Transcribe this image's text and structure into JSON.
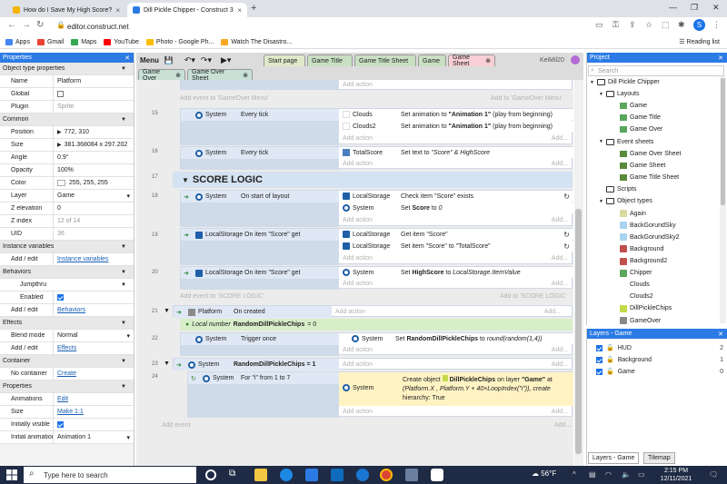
{
  "browser": {
    "tabs": [
      {
        "title": "How do I Save My High Score?",
        "fav_color": "#f4b400"
      },
      {
        "title": "Dill Pickle Chipper - Construct 3",
        "fav_color": "#2c7be5"
      }
    ],
    "url": "editor.construct.net",
    "profile_initial": "S",
    "bookmarks": [
      {
        "label": "Apps",
        "color": "#4285f4"
      },
      {
        "label": "Gmail",
        "color": "#ea4335"
      },
      {
        "label": "Maps",
        "color": "#34a853"
      },
      {
        "label": "YouTube",
        "color": "#ff0000"
      },
      {
        "label": "Photo - Google Ph...",
        "color": "#fbbc04"
      },
      {
        "label": "Watch The Disastro...",
        "color": "#f9a825"
      }
    ],
    "reading_list": "Reading list"
  },
  "properties": {
    "header": "Properties",
    "rows": [
      {
        "k": "Object type properties",
        "sec": true
      },
      {
        "k": "Name",
        "v": "Platform"
      },
      {
        "k": "Global",
        "chk": false
      },
      {
        "k": "Plugin",
        "v": "Sprite",
        "dim": true
      },
      {
        "k": "Common",
        "sec": true
      },
      {
        "k": "Position",
        "v": "772, 310",
        "arr": true
      },
      {
        "k": "Size",
        "v": "381.368084 x 297.202",
        "arr": true
      },
      {
        "k": "Angle",
        "v": "0.9°"
      },
      {
        "k": "Opacity",
        "v": "100%"
      },
      {
        "k": "Color",
        "v": "255, 255, 255",
        "swatch": true
      },
      {
        "k": "Layer",
        "v": "Game"
      },
      {
        "k": "Z elevation",
        "v": "0"
      },
      {
        "k": "Z index",
        "v": "12 of 14",
        "dim": true
      },
      {
        "k": "UID",
        "v": "36",
        "dim": true
      },
      {
        "k": "Instance variables",
        "sec": true
      },
      {
        "k": "Add / edit",
        "link": "Instance variables"
      },
      {
        "k": "Behaviors",
        "sec": true
      },
      {
        "k": "Jumpthru",
        "sub": true
      },
      {
        "k": "Enabled",
        "chk": true,
        "indent": true
      },
      {
        "k": "Add / edit",
        "link": "Behaviors"
      },
      {
        "k": "Effects",
        "sec": true
      },
      {
        "k": "Blend mode",
        "v": "Normal"
      },
      {
        "k": "Add / edit",
        "link": "Effects"
      },
      {
        "k": "Container",
        "sec": true
      },
      {
        "k": "No container",
        "link": "Create"
      },
      {
        "k": "Properties",
        "sec": true
      },
      {
        "k": "Animations",
        "link": "Edit"
      },
      {
        "k": "Size",
        "link": "Make 1:1"
      },
      {
        "k": "Initially visible",
        "chk": true
      },
      {
        "k": "Initial animation",
        "v": "Animation 1"
      }
    ]
  },
  "editor": {
    "menu": "Menu",
    "user": "KeiMil20",
    "tabs": [
      {
        "label": "Start page",
        "bg": "#dfe9c9"
      },
      {
        "label": "Game Title",
        "bg": "#c9e0c2"
      },
      {
        "label": "Game Title Sheet",
        "bg": "#c9e0c2"
      },
      {
        "label": "Game",
        "bg": "#c9e0c2"
      },
      {
        "label": "Game Sheet",
        "bg": "#f8cfd4"
      }
    ],
    "tabs2": [
      "Game Over",
      "Game Over Sheet"
    ],
    "add_action": "Add action",
    "add_event_menu": "Add event to 'GameOver Menu'",
    "add_to_menu": "Add to 'GameOver Menu'",
    "add_event_score": "Add event to 'SCORE LOGIC'",
    "add_to_score": "Add to 'SCORE LOGIC'",
    "add_event": "Add event",
    "add": "Add...",
    "group_title": "SCORE LOGIC",
    "events": [
      {
        "n": "15",
        "cobj": "System",
        "ctxt": "Every tick",
        "acts": [
          {
            "obj": "Clouds",
            "pre": "Set animation to ",
            "b": "\"Animation 1\"",
            "post": " (play from beginning)"
          },
          {
            "obj": "Clouds2",
            "pre": "Set animation to ",
            "b": "\"Animation 1\"",
            "post": " (play from beginning)"
          }
        ]
      },
      {
        "n": "16",
        "cobj": "System",
        "ctxt": "Every tick",
        "acts": [
          {
            "obj": "TotalScore",
            "pre": "Set text to ",
            "i": "\"Score\" & HighScore"
          }
        ]
      },
      {
        "n": "18",
        "cobj": "System",
        "ctxt": "On start of layout",
        "acts": [
          {
            "obj": "LocalStorage",
            "pre": "Check item \"Score\" exists"
          },
          {
            "obj": "System",
            "pre": "Set ",
            "b": "Score",
            "post": " to ",
            "i": "0"
          }
        ]
      },
      {
        "n": "19",
        "cobj": "LocalStorage",
        "ctxt": "On item \"Score\" get",
        "acts": [
          {
            "obj": "LocalStorage",
            "pre": "Get item \"Score\""
          },
          {
            "obj": "LocalStorage",
            "pre": "Set item \"Score\" to \"TotalScore\""
          }
        ]
      },
      {
        "n": "20",
        "cobj": "LocalStorage",
        "ctxt": "On item \"Score\" get",
        "acts": [
          {
            "obj": "System",
            "pre": "Set ",
            "b": "HighScore",
            "post": " to ",
            "i": "LocalStorage.ItemValue"
          }
        ]
      },
      {
        "n": "21",
        "cobj": "Platform",
        "ctxt": "On created",
        "acts": []
      },
      {
        "n": "22",
        "cobj": "System",
        "ctxt": "Trigger once",
        "acts": [
          {
            "obj": "System",
            "pre": "Set ",
            "b": "RandomDillPickleChips",
            "post": " to ",
            "i": "round(random(1,4))"
          }
        ]
      },
      {
        "n": "23",
        "cobj": "System",
        "ctxt": "RandomDillPickleChips = 1",
        "acts": []
      },
      {
        "n": "24",
        "cobj": "System",
        "ctxt": "For \"i\" from 1 to 7",
        "acts": [
          {
            "obj": "System",
            "line1a": "Create object ",
            "line1b": "DillPickleChips",
            "line1c": " on layer ",
            "line1d": "\"Game\"",
            "line1e": " at",
            "line2": "(Platform.X , Platform.Y + 40×LoopIndex(\"i\")), create",
            "line3": "hierarchy: True"
          }
        ]
      }
    ],
    "local_var_pre": "Local number ",
    "local_var_name": "RandomDillPickleChips",
    "local_var_post": " = 0"
  },
  "project": {
    "header": "Project",
    "search": "Search",
    "root": "Dill Pickle Chipper",
    "layouts_label": "Layouts",
    "layouts": [
      "Game",
      "Game Title",
      "Game Over"
    ],
    "sheets_label": "Event sheets",
    "sheets": [
      "Game Over Sheet",
      "Game Sheet",
      "Game Title Sheet"
    ],
    "scripts_label": "Scripts",
    "objtypes_label": "Object types",
    "objtypes": [
      {
        "name": "Again",
        "color": "#d9d9a0"
      },
      {
        "name": "BackGorundSky",
        "color": "#a9d4f0"
      },
      {
        "name": "BackGorundSky2",
        "color": "#a9d4f0"
      },
      {
        "name": "Background",
        "color": "#c0504d"
      },
      {
        "name": "Background2",
        "color": "#c0504d"
      },
      {
        "name": "Chipper",
        "color": "#5aa75c"
      },
      {
        "name": "Clouds",
        "color": "#ffffff"
      },
      {
        "name": "Clouds2",
        "color": "#ffffff"
      },
      {
        "name": "DillPickleChips",
        "color": "#c4d94a"
      },
      {
        "name": "GameOver",
        "color": "#888888"
      }
    ]
  },
  "layers": {
    "header": "Layers - Game",
    "rows": [
      {
        "name": "HUD",
        "count": "2"
      },
      {
        "name": "Background",
        "count": "1"
      },
      {
        "name": "Game",
        "count": "0"
      }
    ],
    "tab1": "Layers - Game",
    "tab2": "Tilemap"
  },
  "taskbar": {
    "search": "Type here to search",
    "weather": "56°F",
    "time": "2:15 PM",
    "date": "12/11/2021"
  }
}
